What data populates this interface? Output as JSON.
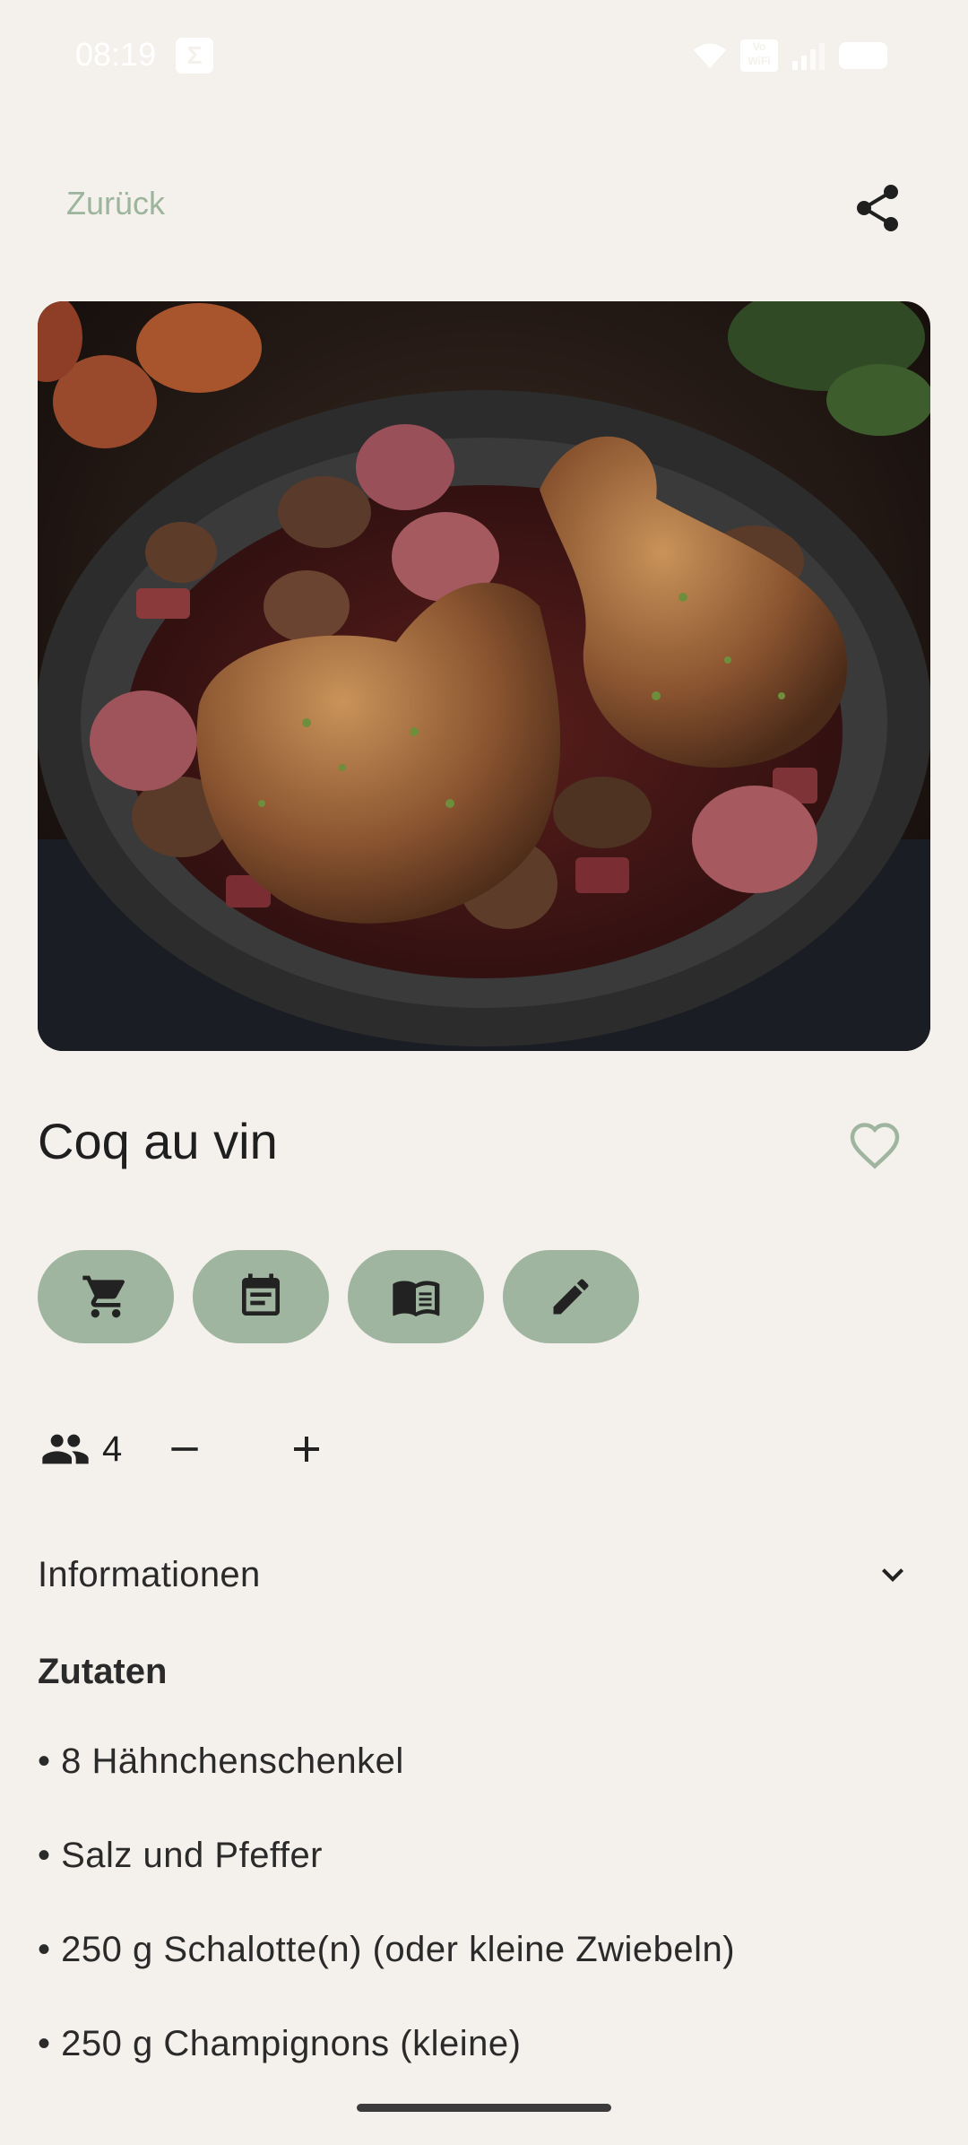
{
  "status_bar": {
    "time": "08:19",
    "sigma_icon": "Σ",
    "vowifi_label": "Vo WiFi"
  },
  "toolbar": {
    "back_label": "Zurück",
    "share_icon": "share-icon"
  },
  "recipe": {
    "image_description": "coq-au-vin-photo",
    "title": "Coq au vin",
    "favorite_icon": "heart-outline-icon"
  },
  "actions": [
    {
      "icon": "shopping-cart-icon"
    },
    {
      "icon": "calendar-note-icon"
    },
    {
      "icon": "open-book-icon"
    },
    {
      "icon": "pencil-icon"
    }
  ],
  "servings": {
    "count": "4",
    "icon": "people-icon"
  },
  "info_section": {
    "label": "Informationen",
    "icon": "chevron-down-icon"
  },
  "ingredients_section": {
    "title": "Zutaten",
    "items": [
      "• 8 Hähnchenschenkel",
      "• Salz und Pfeffer",
      "• 250 g Schalotte(n) (oder kleine Zwiebeln)",
      "• 250 g Champignons (kleine)"
    ]
  },
  "colors": {
    "background": "#f4f1ec",
    "accent": "#9fb59f",
    "accent_text": "#9cb59c",
    "text": "#1f1f1f"
  }
}
